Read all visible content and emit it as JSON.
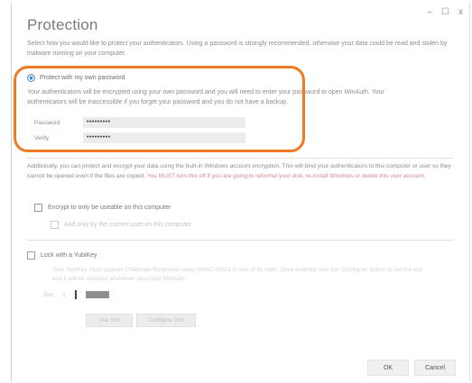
{
  "window": {
    "minimize_glyph": "–",
    "restore_glyph": "☐",
    "close_glyph": "x"
  },
  "title": "Protection",
  "description": "Select how you would like to protect your authenticators. Using a password is strongly recommended, otherwise your data could be read and stolen by malware running on your computer.",
  "password_option": {
    "label": "Protect with my own password",
    "selected": true,
    "description": "Your authenticators will be encrypted using your own password and you will need to enter your password to open WinAuth. Your authenticators will be inaccessible if you forget your password and you do not have a backup.",
    "password_label": "Password",
    "password_value": "•••••••••",
    "verify_label": "Verify",
    "verify_value": "•••••••••"
  },
  "windows_encryption": {
    "description_part1": "Additionally, you can protect and encrypt your data using the built-in Windows account encryption. This will bind your authenticators to this computer or user so they cannot be opened even if the files are copied.",
    "description_must": "You MUST turn this off if you are going to reformat your disk, re-install Windows or delete this user account.",
    "encrypt_label": "Encrypt to only be useable on this computer",
    "encrypt_checked": false,
    "user_only_label": "And only by the current user on this computer",
    "user_only_checked": false
  },
  "yubikey": {
    "label": "Lock with a YubiKey",
    "checked": false,
    "description": "Your YubiKey must support Challenge-Response using HMAC-SHA1 in one of its slots. Once enabled, use the 'Configure' button to set the slot and it will be checked whenever you open WinAuth.",
    "slot_label": "Slot",
    "slot_number": "1",
    "use_slot_label": "Use Slot",
    "configure_slot_label": "Configure Slot"
  },
  "buttons": {
    "ok": "OK",
    "cancel": "Cancel"
  },
  "colors": {
    "highlight": "#f07a23",
    "accent": "#4a8fd0"
  }
}
